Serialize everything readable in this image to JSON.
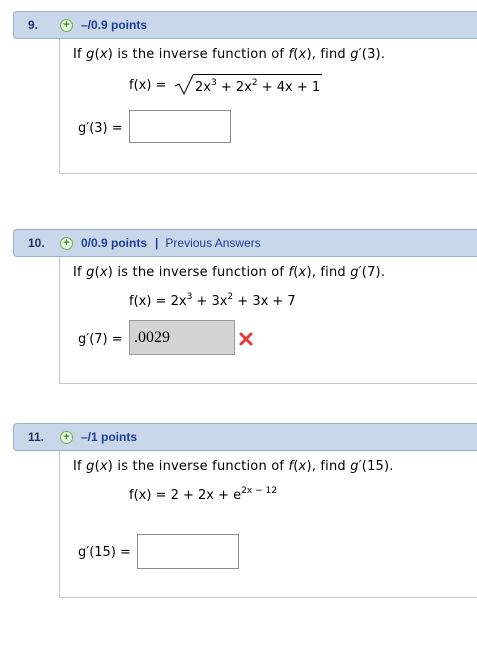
{
  "questions": [
    {
      "number": "9.",
      "points": "–/0.9 points",
      "prompt": {
        "pre": "If ",
        "g": "g",
        "mid1": "(",
        "x1": "x",
        "mid2": ") is the inverse function of ",
        "f": "f",
        "mid3": "(",
        "x2": "x",
        "mid4": "), find ",
        "gp": "g",
        "post": "′(3)."
      },
      "formula": {
        "lhs": "f(x) =",
        "expr": "2x",
        "e1": "3",
        "mid": " + 2x",
        "e2": "2",
        "tail": " + 4x + 1"
      },
      "answer_label": "g′(3) =",
      "answer_value": ""
    },
    {
      "number": "10.",
      "points": "0/0.9 points",
      "separator": "|",
      "previous_answers": "Previous Answers",
      "prompt": {
        "pre": "If ",
        "g": "g",
        "mid1": "(",
        "x1": "x",
        "mid2": ") is the inverse function of ",
        "f": "f",
        "mid3": "(",
        "x2": "x",
        "mid4": "), find ",
        "gp": "g",
        "post": "′(7)."
      },
      "formula": {
        "lhs": "f(x) =",
        "expr": "2x",
        "e1": "3",
        "mid": " + 3x",
        "e2": "2",
        "tail": " + 3x + 7"
      },
      "answer_label": "g′(7) =",
      "answer_value": ".0029",
      "status": "incorrect"
    },
    {
      "number": "11.",
      "points": "–/1 points",
      "prompt": {
        "pre": "If ",
        "g": "g",
        "mid1": "(",
        "x1": "x",
        "mid2": ") is the inverse function of ",
        "f": "f",
        "mid3": "(",
        "x2": "x",
        "mid4": "), find ",
        "gp": "g",
        "post": "′(15)."
      },
      "formula": {
        "lhs": "f(x) =",
        "expr": "2 + 2x + e",
        "e1": "2x − 12"
      },
      "answer_label": "g′(15) =",
      "answer_value": ""
    }
  ],
  "colors": {
    "header_bg": "#c8d7ea",
    "link": "#1f3d91",
    "wrong": "#e23b3b"
  }
}
